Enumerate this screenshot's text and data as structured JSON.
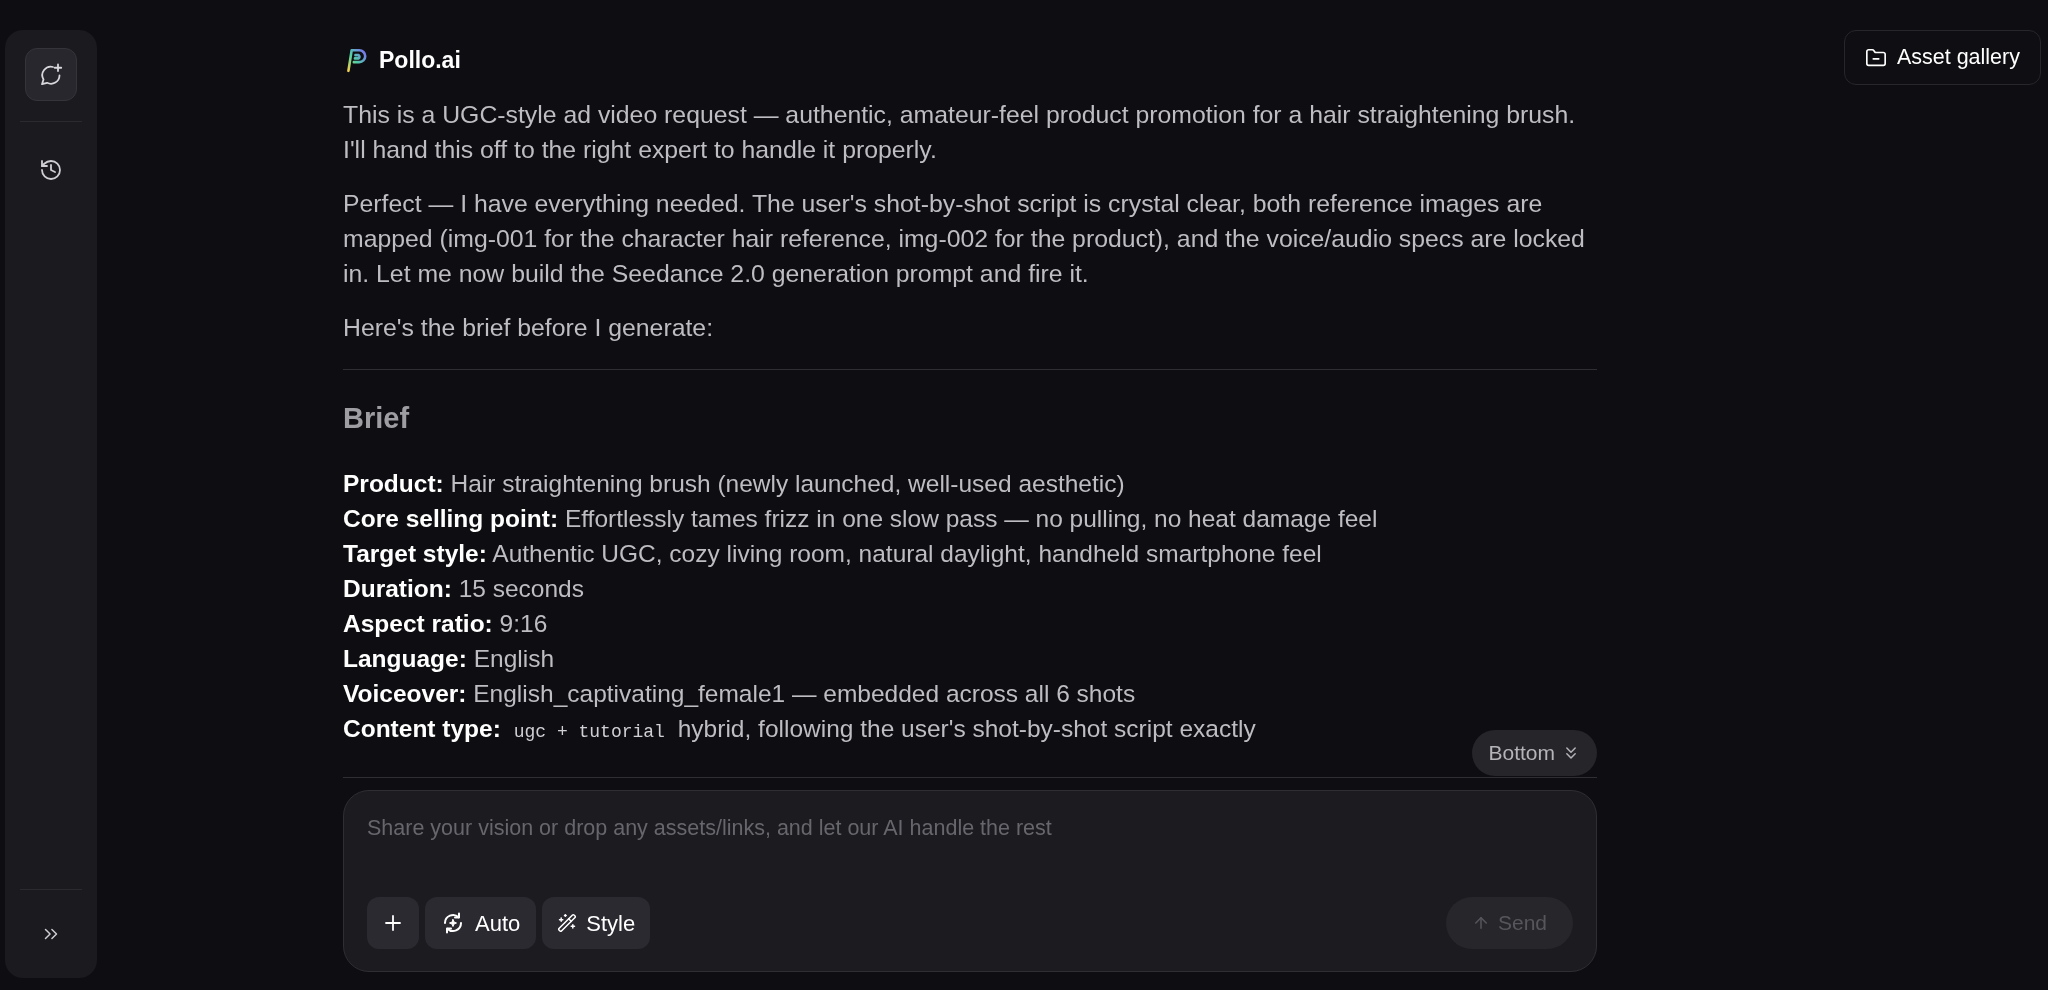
{
  "asset_gallery": {
    "label": "Asset gallery"
  },
  "header": {
    "assistant_name": "Pollo.ai"
  },
  "messages": [
    "This is a UGC-style ad video request — authentic, amateur-feel product promotion for a hair straightening brush. I'll hand this off to the right expert to handle it properly.",
    "Perfect — I have everything needed. The user's shot-by-shot script is crystal clear, both reference images are mapped (img-001 for the character hair reference, img-002 for the product), and the voice/audio specs are locked in. Let me now build the Seedance 2.0 generation prompt and fire it.",
    "Here's the brief before I generate:"
  ],
  "brief": {
    "title": "Brief",
    "items": [
      {
        "label": "Product:",
        "value": "Hair straightening brush (newly launched, well-used aesthetic)"
      },
      {
        "label": "Core selling point:",
        "value": "Effortlessly tames frizz in one slow pass — no pulling, no heat damage feel"
      },
      {
        "label": "Target style:",
        "value": "Authentic UGC, cozy living room, natural daylight, handheld smartphone feel"
      },
      {
        "label": "Duration:",
        "value": "15 seconds"
      },
      {
        "label": "Aspect ratio:",
        "value": "9:16"
      },
      {
        "label": "Language:",
        "value": "English"
      },
      {
        "label": "Voiceover:",
        "value": "English_captivating_female1 — embedded across all 6 shots"
      },
      {
        "label": "Content type:",
        "code": "ugc + tutorial",
        "value": "hybrid, following the user's shot-by-shot script exactly"
      }
    ]
  },
  "scroll_button": {
    "label": "Bottom"
  },
  "composer": {
    "placeholder": "Share your vision or drop any assets/links, and let our AI handle the rest",
    "buttons": [
      {
        "kind": "add"
      },
      {
        "kind": "mode",
        "label": "Auto"
      },
      {
        "kind": "style",
        "label": "Style"
      }
    ],
    "send": {
      "label": "Send",
      "disabled": true
    }
  }
}
